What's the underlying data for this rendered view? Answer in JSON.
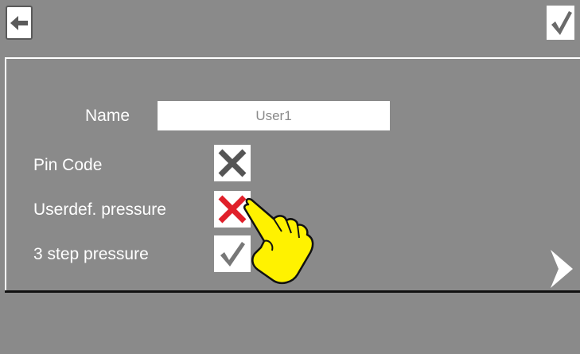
{
  "top_bar": {
    "back_icon": "arrow-left-icon",
    "confirm_icon": "checkmark-icon"
  },
  "form": {
    "name_label": "Name",
    "name_value": "User1",
    "rows": [
      {
        "label": "Pin Code",
        "state": "unchecked",
        "mark_color": "#555555"
      },
      {
        "label": "Userdef. pressure",
        "state": "unchecked",
        "mark_color": "#e0202a"
      },
      {
        "label": "3 step pressure",
        "state": "checked",
        "mark_color": "#777777"
      }
    ]
  },
  "navigation": {
    "next_icon": "chevron-right-icon"
  },
  "overlay": {
    "pointer_icon": "hand-pointer-icon",
    "pointer_color": "#fff200"
  }
}
